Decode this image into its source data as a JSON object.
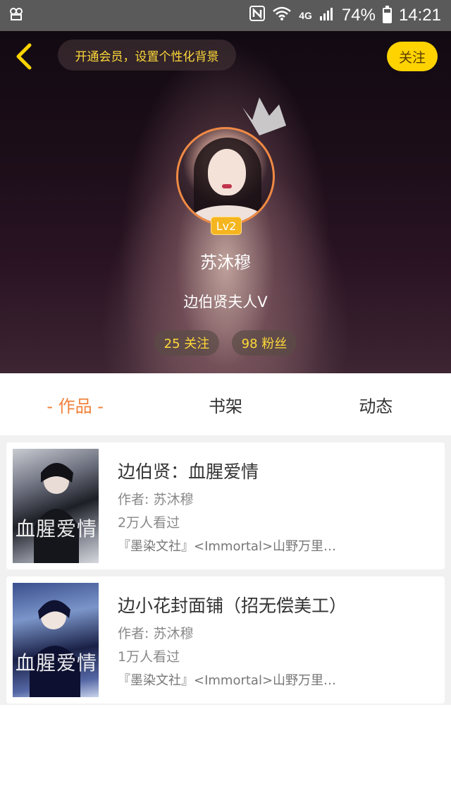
{
  "status_bar": {
    "battery": "74%",
    "battery_level": 0.74,
    "network": "4G",
    "time": "14:21"
  },
  "header": {
    "vip_prompt": "开通会员，设置个性化背景",
    "follow_label": "关注"
  },
  "profile": {
    "level": "Lv2",
    "name": "苏沐穆",
    "signature": "边伯贤夫人V",
    "following": "25 关注",
    "fans": "98 粉丝"
  },
  "tabs": [
    {
      "label": "- 作品 -",
      "active": true
    },
    {
      "label": "书架",
      "active": false
    },
    {
      "label": "动态",
      "active": false
    }
  ],
  "books": [
    {
      "title": "边伯贤：血腥爱情",
      "author": "作者: 苏沐穆",
      "views": "2万人看过",
      "tags": "『墨染文社』<Immortal>山野万里…",
      "cover_text": "血腥爱情"
    },
    {
      "title": "边小花封面铺（招无偿美工）",
      "author": "作者: 苏沐穆",
      "views": "1万人看过",
      "tags": "『墨染文社』<Immortal>山野万里…",
      "cover_text": "血腥爱情"
    }
  ],
  "colors": {
    "accent": "#f0813a",
    "highlight": "#ffd300",
    "badge": "#f5b51f"
  }
}
